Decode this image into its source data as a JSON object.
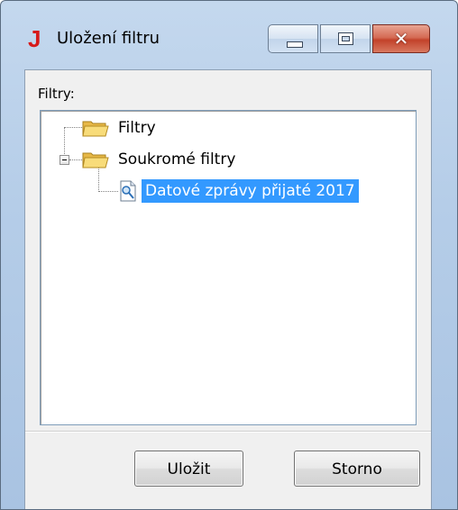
{
  "window": {
    "title": "Uložení filtru",
    "app_icon_glyph": "J",
    "app_icon_color": "#d61a1a",
    "icons": {
      "app": "j-app-icon",
      "minimize": "minimize-icon",
      "maximize": "maximize-icon",
      "close": "close-icon"
    },
    "close_glyph": "✕"
  },
  "filters": {
    "label": "Filtry:",
    "tree": [
      {
        "label": "Filtry",
        "icon": "folder-icon",
        "level": 0,
        "expanded": false,
        "selected": false
      },
      {
        "label": "Soukromé filtry",
        "icon": "folder-icon",
        "level": 0,
        "expanded": true,
        "selected": false,
        "children": [
          {
            "label": "Datové zprávy přijaté 2017",
            "icon": "filter-document-icon",
            "level": 1,
            "selected": true
          }
        ]
      }
    ],
    "selection_color": "#3399ff"
  },
  "buttons": {
    "save_label": "Uložit",
    "cancel_label": "Storno"
  }
}
